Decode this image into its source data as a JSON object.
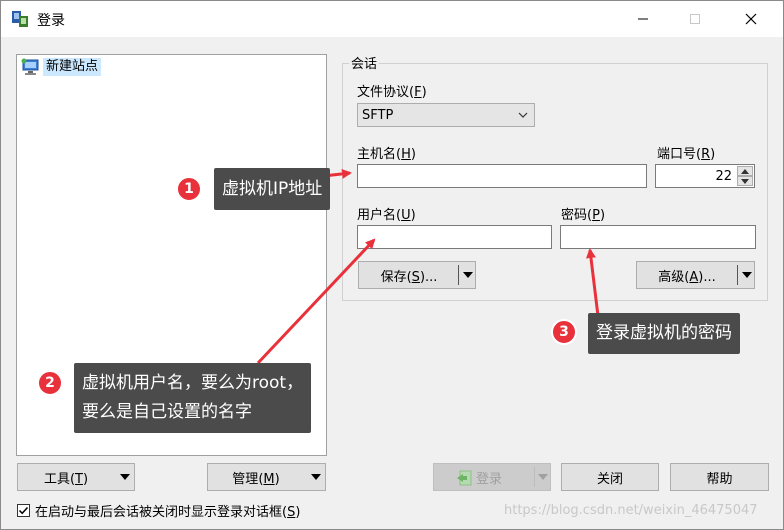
{
  "window": {
    "title": "登录"
  },
  "tree": {
    "items": [
      {
        "label": "新建站点"
      }
    ]
  },
  "session": {
    "group_title": "会话",
    "protocol_label": "文件协议",
    "protocol_key": "F",
    "protocol_value": "SFTP",
    "host_label": "主机名",
    "host_key": "H",
    "host_value": "",
    "port_label": "端口号",
    "port_key": "R",
    "port_value": "22",
    "user_label": "用户名",
    "user_key": "U",
    "user_value": "",
    "password_label": "密码",
    "password_key": "P",
    "password_value": "",
    "save_label": "保存",
    "save_key": "S",
    "advanced_label": "高级",
    "advanced_key": "A"
  },
  "bottom": {
    "tools_label": "工具",
    "tools_key": "T",
    "manage_label": "管理",
    "manage_key": "M",
    "login_label": "登录",
    "close_label": "关闭",
    "help_label": "帮助",
    "checkbox_label": "在启动与最后会话被关闭时显示登录对话框",
    "checkbox_key": "S",
    "checkbox_checked": true
  },
  "annotations": {
    "callout1": {
      "number": "1",
      "text": "虚拟机IP地址"
    },
    "callout2": {
      "number": "2",
      "line1": "虚拟机用户名，要么为root，",
      "line2": "要么是自己设置的名字"
    },
    "callout3": {
      "number": "3",
      "text": "登录虚拟机的密码"
    }
  },
  "watermark": "https://blog.csdn.net/weixin_46475047",
  "colors": {
    "callout_bg": "#4b4b4b",
    "badge": "#e8313b",
    "arrow": "#e8313b",
    "selection": "#cce8ff"
  }
}
